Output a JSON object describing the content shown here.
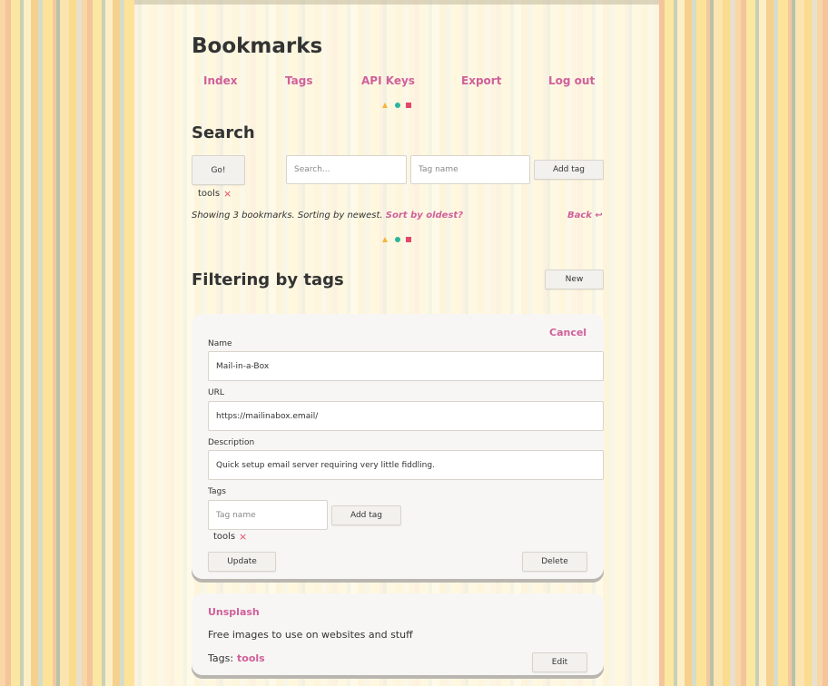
{
  "site": {
    "title": "Bookmarks"
  },
  "nav": {
    "index": "Index",
    "tags": "Tags",
    "api_keys": "API Keys",
    "export": "Export",
    "log_out": "Log out"
  },
  "search": {
    "heading": "Search",
    "go_label": "Go!",
    "query_placeholder": "Search...",
    "tag_placeholder": "Tag name",
    "add_tag_label": "Add tag",
    "active_tag": "tools",
    "remove_symbol": "×"
  },
  "status": {
    "text": "Showing 3 bookmarks. Sorting by newest.",
    "sort_link": "Sort by oldest?",
    "back_link": "Back ↩"
  },
  "filter": {
    "heading": "Filtering by tags",
    "new_label": "New"
  },
  "edit_form": {
    "cancel_label": "Cancel",
    "name_label": "Name",
    "name_value": "Mail-in-a-Box",
    "url_label": "URL",
    "url_value": "https://mailinabox.email/",
    "description_label": "Description",
    "description_value": "Quick setup email server requiring very little fiddling.",
    "tags_label": "Tags",
    "tag_placeholder": "Tag name",
    "add_tag_label": "Add tag",
    "tag": "tools",
    "remove_symbol": "×",
    "update_label": "Update",
    "delete_label": "Delete"
  },
  "bookmark": {
    "title": "Unsplash",
    "description": "Free images to use on websites and stuff",
    "tags_prefix": "Tags:",
    "tag": "tools",
    "edit_label": "Edit"
  },
  "colors": {
    "accent": "#d0609a",
    "danger": "#e5476b",
    "triangle": "#f4b63a",
    "dot": "#2bb59a"
  }
}
